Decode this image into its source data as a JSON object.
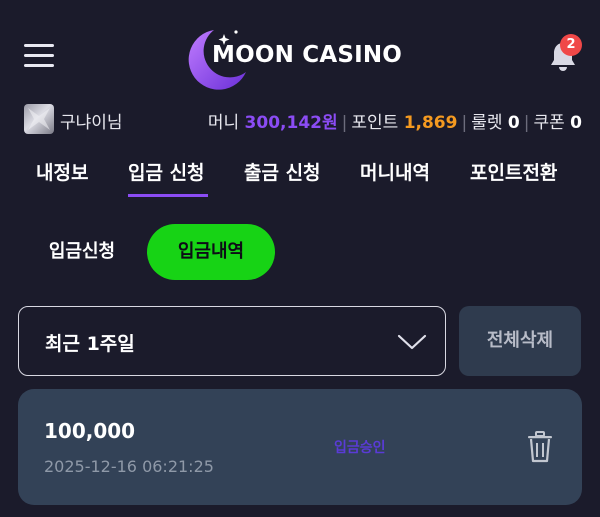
{
  "header": {
    "logo_text": "MOON CASINO",
    "notification_count": "2"
  },
  "user": {
    "name": "구냐이님",
    "money_label": "머니",
    "money_value": "300,142원",
    "point_label": "포인트",
    "point_value": "1,869",
    "roulette_label": "룰렛",
    "roulette_value": "0",
    "coupon_label": "쿠폰",
    "coupon_value": "0"
  },
  "tabs": [
    {
      "label": "내정보"
    },
    {
      "label": "입금 신청"
    },
    {
      "label": "출금 신청"
    },
    {
      "label": "머니내역"
    },
    {
      "label": "포인트전환"
    }
  ],
  "subtabs": {
    "request": "입금신청",
    "history": "입금내역"
  },
  "filter": {
    "selected": "최근 1주일",
    "delete_all": "전체삭제"
  },
  "records": [
    {
      "amount": "100,000",
      "date": "2025-12-16 06:21:25",
      "status": "입금승인"
    }
  ],
  "colors": {
    "background": "#1b1b2b",
    "accent_purple": "#8b4cf4",
    "accent_orange": "#f59a20",
    "active_green": "#17d315",
    "card_bg": "#334257",
    "badge_red": "#f04848"
  },
  "icons": [
    "menu-icon",
    "moon-logo-icon",
    "bell-icon",
    "chevron-down-icon",
    "trash-icon"
  ]
}
